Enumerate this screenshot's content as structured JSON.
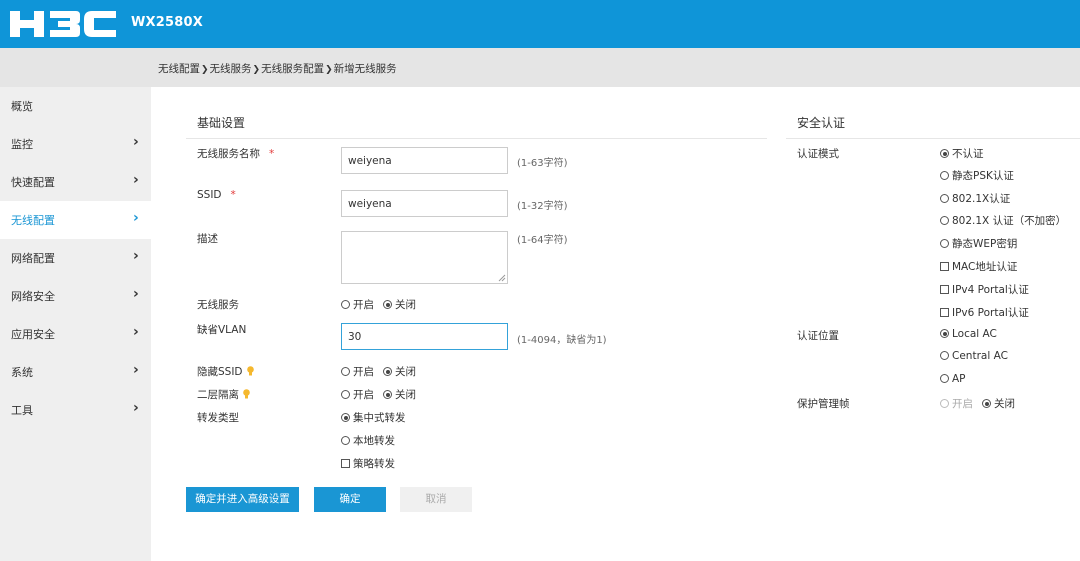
{
  "header": {
    "logo_text": "H3C",
    "model": "WX2580X",
    "bg_color": "#0f95d8"
  },
  "breadcrumb": [
    "无线配置",
    "无线服务",
    "无线服务配置",
    "新增无线服务"
  ],
  "sidebar": {
    "active_color": "#1a96d4",
    "items": [
      {
        "label": "概览",
        "has_arrow": false
      },
      {
        "label": "监控",
        "has_arrow": true
      },
      {
        "label": "快速配置",
        "has_arrow": true
      },
      {
        "label": "无线配置",
        "has_arrow": true,
        "active": true
      },
      {
        "label": "网络配置",
        "has_arrow": true
      },
      {
        "label": "网络安全",
        "has_arrow": true
      },
      {
        "label": "应用安全",
        "has_arrow": true
      },
      {
        "label": "系统",
        "has_arrow": true
      },
      {
        "label": "工具",
        "has_arrow": true
      }
    ],
    "arrow": "›"
  },
  "basic": {
    "title": "基础设置",
    "service_name": {
      "label": "无线服务名称",
      "required_mark": "*",
      "value": "weiyena",
      "hint": "(1-63字符)"
    },
    "ssid": {
      "label": "SSID",
      "required_mark": "*",
      "value": "weiyena",
      "hint": "(1-32字符)"
    },
    "description": {
      "label": "描述",
      "value": "",
      "hint": "(1-64字符)"
    },
    "wireless_service": {
      "label": "无线服务",
      "options": [
        "开启",
        "关闭"
      ],
      "selected": "关闭"
    },
    "default_vlan": {
      "label": "缺省VLAN",
      "value": "30",
      "hint": "(1-4094，缺省为1)"
    },
    "hide_ssid": {
      "label": "隐藏SSID",
      "icon": "lightbulb-icon",
      "options": [
        "开启",
        "关闭"
      ],
      "selected": "关闭"
    },
    "l2_isolation": {
      "label": "二层隔离",
      "icon": "lightbulb-icon",
      "options": [
        "开启",
        "关闭"
      ],
      "selected": "关闭"
    },
    "forward_type": {
      "label": "转发类型",
      "options": [
        "集中式转发",
        "本地转发"
      ],
      "selected": "集中式转发",
      "policy_checkbox": "策略转发",
      "policy_checked": false
    }
  },
  "security": {
    "title": "安全认证",
    "auth_mode": {
      "label": "认证模式",
      "radio_options": [
        "不认证",
        "静态PSK认证",
        "802.1X认证",
        "802.1X 认证（不加密）",
        "静态WEP密钥"
      ],
      "selected": "不认证",
      "checkbox_options": [
        "MAC地址认证",
        "IPv4 Portal认证",
        "IPv6 Portal认证"
      ]
    },
    "auth_location": {
      "label": "认证位置",
      "options": [
        "Local AC",
        "Central AC",
        "AP"
      ],
      "selected": "Local AC"
    },
    "pmf": {
      "label": "保护管理帧",
      "options": [
        "开启",
        "关闭"
      ],
      "selected": "关闭",
      "on_disabled": true
    }
  },
  "buttons": {
    "advanced": "确定并进入高级设置",
    "ok": "确定",
    "cancel": "取消"
  }
}
